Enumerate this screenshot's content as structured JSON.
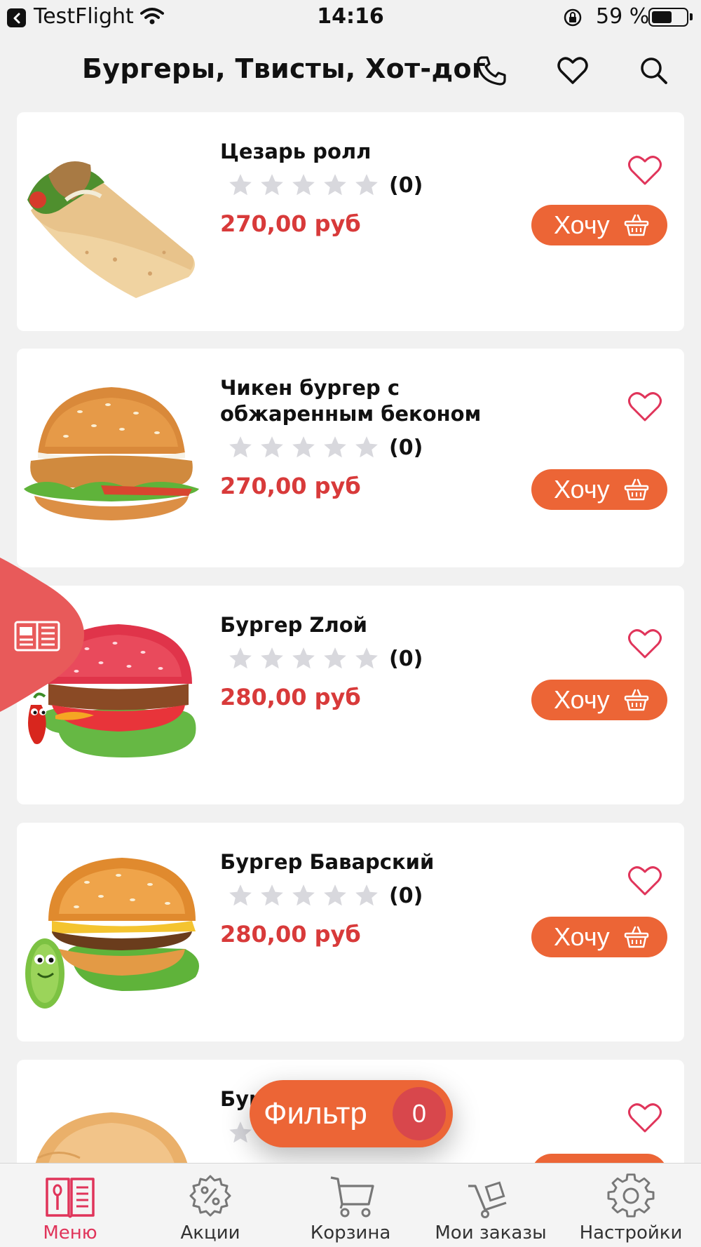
{
  "status_bar": {
    "app": "TestFlight",
    "time": "14:16",
    "battery": "59 %"
  },
  "header": {
    "title": "Бургеры, Твисты, Хот-дог",
    "icons": [
      "phone-icon",
      "heart-icon",
      "search-icon"
    ]
  },
  "products": [
    {
      "name": "Цезарь ролл",
      "rating_count": "(0)",
      "price": "270,00 руб",
      "want": "Хочу"
    },
    {
      "name": "Чикен бургер с обжаренным беконом",
      "rating_count": "(0)",
      "price": "270,00 руб",
      "want": "Хочу"
    },
    {
      "name": "Бургер Zлой",
      "rating_count": "(0)",
      "price": "280,00 руб",
      "want": "Хочу"
    },
    {
      "name": "Бургер Баварский",
      "rating_count": "(0)",
      "price": "280,00 руб",
      "want": "Хочу"
    },
    {
      "name": "Бур",
      "rating_count": "",
      "price": "",
      "want": ""
    }
  ],
  "filter": {
    "label": "Фильтр",
    "count": "0"
  },
  "nav": {
    "items": [
      {
        "label": "Меню",
        "icon": "menu-book-icon",
        "active": true
      },
      {
        "label": "Акции",
        "icon": "percent-gear-icon",
        "active": false
      },
      {
        "label": "Корзина",
        "icon": "cart-icon",
        "active": false
      },
      {
        "label": "Мои заказы",
        "icon": "cart-box-icon",
        "active": false
      },
      {
        "label": "Настройки",
        "icon": "gear-icon",
        "active": false
      }
    ]
  },
  "colors": {
    "accent": "#ec6536",
    "price": "#d83a3a",
    "heart": "#e0345a",
    "side_tab": "#e85a5a",
    "star": "#d8d8dd",
    "background": "#f1f1f1"
  }
}
